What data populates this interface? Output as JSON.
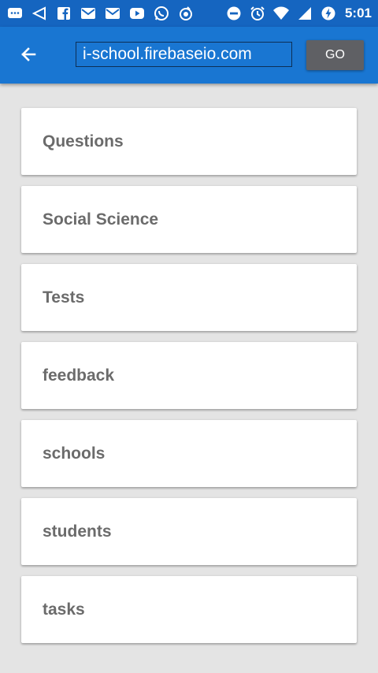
{
  "status_bar": {
    "time": "5:01",
    "icons": [
      "chat-bubble-icon",
      "send-icon",
      "facebook-icon",
      "mail-icon",
      "mail-icon",
      "youtube-icon",
      "whatsapp-icon",
      "app-icon",
      "do-not-disturb-icon",
      "alarm-icon",
      "wifi-icon",
      "signal-icon",
      "battery-saver-icon"
    ]
  },
  "toolbar": {
    "back_icon": "arrow-left-icon",
    "url_value": "i-school.firebaseio.com",
    "go_label": "GO"
  },
  "list": {
    "items": [
      {
        "label": "Questions"
      },
      {
        "label": "Social Science"
      },
      {
        "label": "Tests"
      },
      {
        "label": "feedback"
      },
      {
        "label": "schools"
      },
      {
        "label": "students"
      },
      {
        "label": "tasks"
      }
    ]
  },
  "colors": {
    "status_bar": "#1565c0",
    "toolbar": "#1976d2",
    "background": "#e4e4e4",
    "go_button": "#5f6064",
    "item_text": "#6b6b6b"
  }
}
